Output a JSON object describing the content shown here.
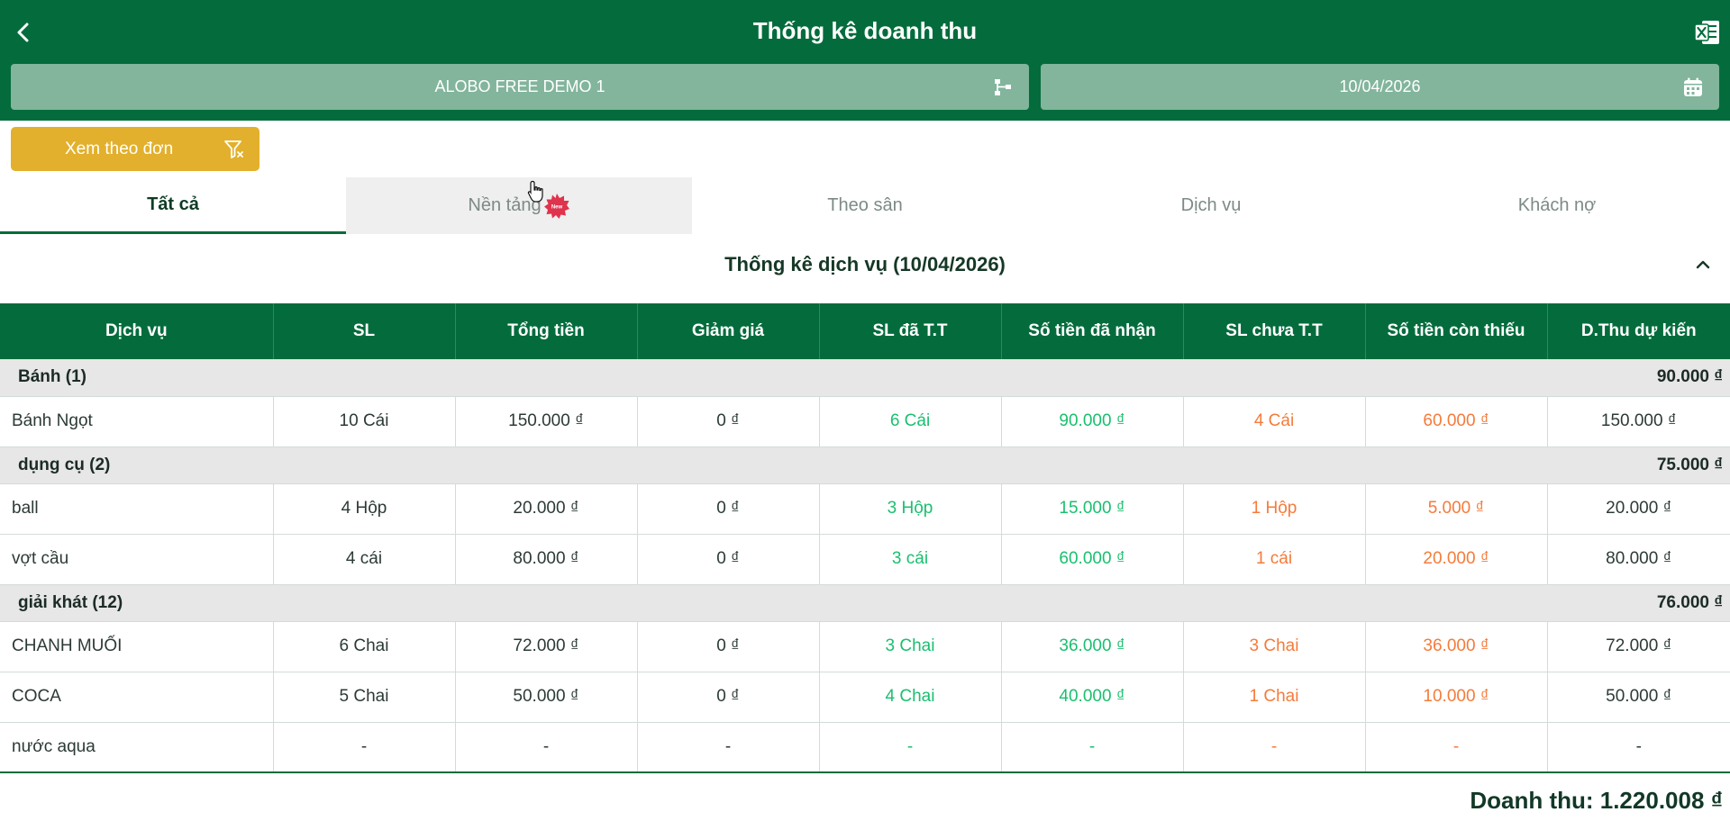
{
  "header": {
    "title": "Thống kê doanh thu"
  },
  "selectors": {
    "branch": "ALOBO FREE DEMO 1",
    "date": "10/04/2026"
  },
  "filter_button": {
    "label": "Xem theo đơn"
  },
  "tabs": [
    {
      "label": "Tất cả"
    },
    {
      "label": "Nền tảng",
      "badge": "New"
    },
    {
      "label": "Theo sân"
    },
    {
      "label": "Dịch vụ"
    },
    {
      "label": "Khách nợ"
    }
  ],
  "section": {
    "title": "Thống kê dịch vụ (10/04/2026)"
  },
  "table": {
    "columns": [
      "Dịch vụ",
      "SL",
      "Tổng tiền",
      "Giảm giá",
      "SL đã T.T",
      "Số tiền đã nhận",
      "SL chưa T.T",
      "Số tiền còn thiếu",
      "D.Thu dự kiến"
    ],
    "groups": [
      {
        "name": "Bánh (1)",
        "total": "90.000 ₫",
        "rows": [
          [
            "Bánh Ngọt",
            "10 Cái",
            "150.000 ₫",
            "0 ₫",
            "6 Cái",
            "90.000 ₫",
            "4 Cái",
            "60.000 ₫",
            "150.000 ₫"
          ]
        ]
      },
      {
        "name": "dụng cụ (2)",
        "total": "75.000 ₫",
        "rows": [
          [
            "ball",
            "4 Hộp",
            "20.000 ₫",
            "0 ₫",
            "3 Hộp",
            "15.000 ₫",
            "1 Hộp",
            "5.000 ₫",
            "20.000 ₫"
          ],
          [
            "vợt cầu",
            "4 cái",
            "80.000 ₫",
            "0 ₫",
            "3 cái",
            "60.000 ₫",
            "1 cái",
            "20.000 ₫",
            "80.000 ₫"
          ]
        ]
      },
      {
        "name": "giải khát (12)",
        "total": "76.000 ₫",
        "rows": [
          [
            "CHANH MUỐI",
            "6 Chai",
            "72.000 ₫",
            "0 ₫",
            "3 Chai",
            "36.000 ₫",
            "3 Chai",
            "36.000 ₫",
            "72.000 ₫"
          ],
          [
            "COCA",
            "5 Chai",
            "50.000 ₫",
            "0 ₫",
            "4 Chai",
            "40.000 ₫",
            "1 Chai",
            "10.000 ₫",
            "50.000 ₫"
          ],
          [
            "nước aqua",
            "-",
            "-",
            "-",
            "-",
            "-",
            "-",
            "-",
            "-"
          ]
        ]
      }
    ]
  },
  "footer": {
    "revenue": "Doanh thu: 1.220.008 ₫"
  },
  "colors": {
    "primary": "#046c3c",
    "accent": "#e2b02c",
    "paid": "#1abf6f",
    "unpaid": "#f57b3a",
    "selector_bg": "#82b59c"
  },
  "icons": {
    "back": "chevron-left-icon",
    "export": "excel-icon",
    "branch": "branch-icon",
    "date": "calendar-icon",
    "filter": "filter-icon",
    "collapse": "chevron-up-icon"
  }
}
